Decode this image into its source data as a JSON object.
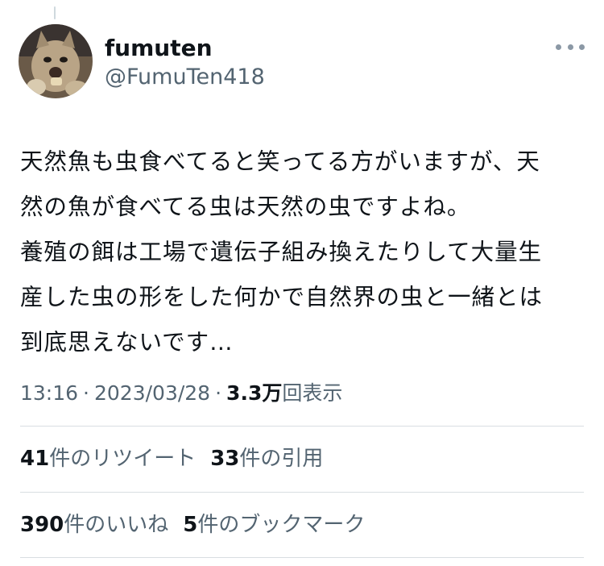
{
  "author": {
    "display_name": "fumuten",
    "handle": "@FumuTen418"
  },
  "tweet": {
    "text_lines": [
      "天然魚も虫食べてると笑ってる方がいますが、天",
      "然の魚が食べてる虫は天然の虫ですよね。",
      "養殖の餌は工場で遺伝子組み換えたりして大量生",
      "産した虫の形をした何かで自然界の虫と一緒とは",
      "到底思えないです…"
    ]
  },
  "meta": {
    "time": "13:16",
    "separator": "·",
    "date": "2023/03/28",
    "views_count": "3.3万",
    "views_label": "回表示"
  },
  "stats": {
    "retweets": {
      "count": "41",
      "label": "件のリツイート"
    },
    "quotes": {
      "count": "33",
      "label": "件の引用"
    },
    "likes": {
      "count": "390",
      "label": "件のいいね"
    },
    "bookmarks": {
      "count": "5",
      "label": "件のブックマーク"
    }
  },
  "icons": [
    "more-options-icon"
  ]
}
